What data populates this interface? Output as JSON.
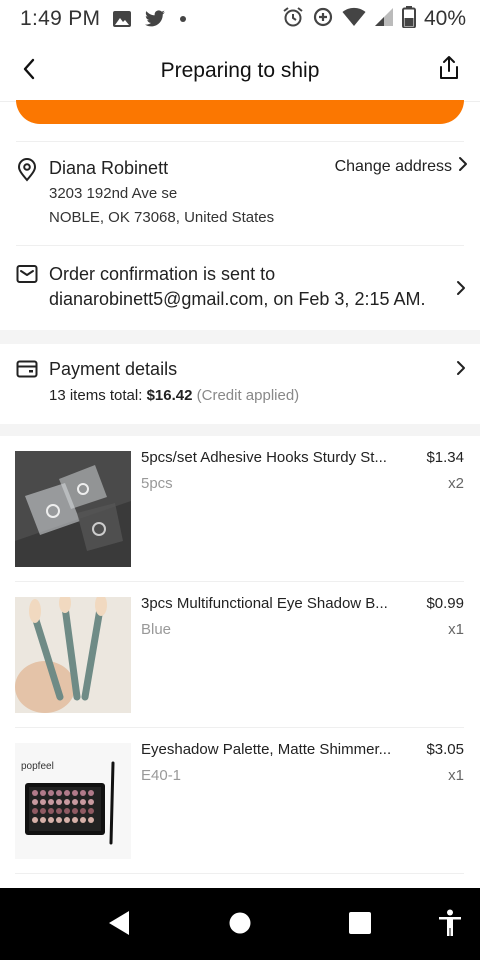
{
  "status_bar": {
    "time": "1:49 PM",
    "battery": "40%",
    "icons": [
      "image-icon",
      "twitter-icon",
      "dot-icon",
      "alarm-icon",
      "data-saver-icon",
      "wifi-icon",
      "signal-icon",
      "battery-icon"
    ]
  },
  "header": {
    "title": "Preparing to ship",
    "back_icon": "chevron-left-icon",
    "share_icon": "share-icon"
  },
  "colors": {
    "accent": "#fb7701",
    "divider": "#efefef",
    "section_gap": "#f4f4f4"
  },
  "address": {
    "name": "Diana Robinett",
    "line1": "3203 192nd Ave se",
    "line2": "NOBLE, OK 73068, United States",
    "change_label": "Change address"
  },
  "email": {
    "line1": "Order confirmation is sent to",
    "line2": "dianarobinett5@gmail.com, on Feb 3, 2:15 AM."
  },
  "payment": {
    "title": "Payment details",
    "items_label": "13 items total:",
    "amount": "$16.42",
    "note": "(Credit applied)"
  },
  "items": [
    {
      "title": "5pcs/set Adhesive Hooks Sturdy St...",
      "variant": "5pcs",
      "price": "$1.34",
      "qty": "x2"
    },
    {
      "title": "3pcs Multifunctional Eye Shadow B...",
      "variant": "Blue",
      "price": "$0.99",
      "qty": "x1"
    },
    {
      "title": "Eyeshadow Palette, Matte Shimmer...",
      "variant": "E40-1",
      "price": "$3.05",
      "qty": "x1",
      "brand": "popfeel"
    }
  ],
  "nav_bar": {
    "icons": [
      "back-triangle-icon",
      "home-circle-icon",
      "recents-square-icon",
      "accessibility-icon"
    ]
  }
}
